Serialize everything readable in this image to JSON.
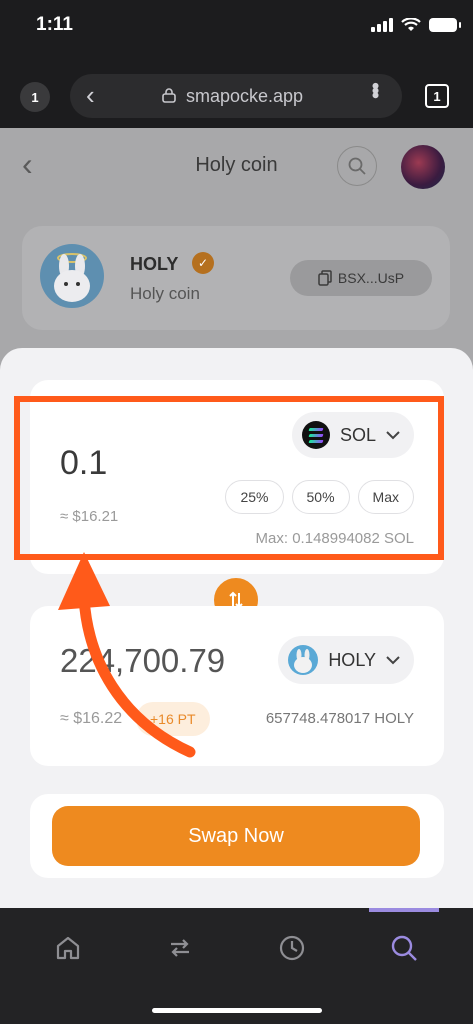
{
  "status_bar": {
    "time": "1:11"
  },
  "browser": {
    "tab_count_left": "1",
    "url": "smapocke.app",
    "tabs_count": "1"
  },
  "page": {
    "title": "Holy coin",
    "token": {
      "symbol": "HOLY",
      "name": "Holy coin",
      "address": "BSX...UsP"
    }
  },
  "swap": {
    "from": {
      "amount": "0.1",
      "fiat": "≈ $16.21",
      "token": "SOL",
      "percent_buttons": [
        "25%",
        "50%",
        "Max"
      ],
      "max_label": "Max: 0.148994082 SOL"
    },
    "to": {
      "amount": "224,700.79",
      "fiat": "≈ $16.22",
      "badge": "+16 PT",
      "token": "HOLY",
      "balance": "657748.478017 HOLY"
    },
    "button_label": "Swap Now"
  },
  "colors": {
    "accent": "#ee8a1f",
    "annotation": "#ff5a1a",
    "nav_active": "#9b8be0"
  }
}
